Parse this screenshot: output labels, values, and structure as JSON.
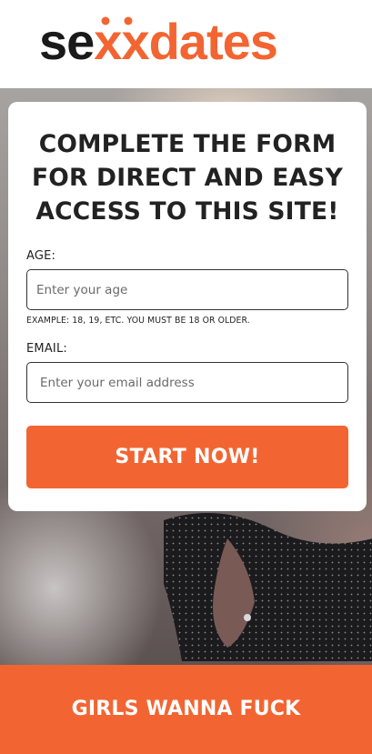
{
  "brand": {
    "logo_text": "sexxdates",
    "logo_prefix": "se",
    "logo_xx": "xx",
    "logo_suffix": "dates",
    "colors": {
      "dark": "#1a1a1a",
      "accent": "#f26532"
    }
  },
  "form": {
    "title": "COMPLETE THE FORM FOR DIRECT AND EASY ACCESS TO THIS SITE!",
    "age": {
      "label": "AGE:",
      "placeholder": "Enter your age",
      "value": "",
      "hint": "EXAMPLE: 18, 19, ETC. YOU MUST BE 18 OR OLDER."
    },
    "email": {
      "label": "EMAIL:",
      "placeholder": "Enter your email address",
      "value": ""
    },
    "submit_label": "START NOW!"
  },
  "footer": {
    "text": "GIRLS WANNA FUCK"
  },
  "colors": {
    "accent": "#f26532",
    "card_bg": "#ffffff",
    "text": "#222222"
  }
}
